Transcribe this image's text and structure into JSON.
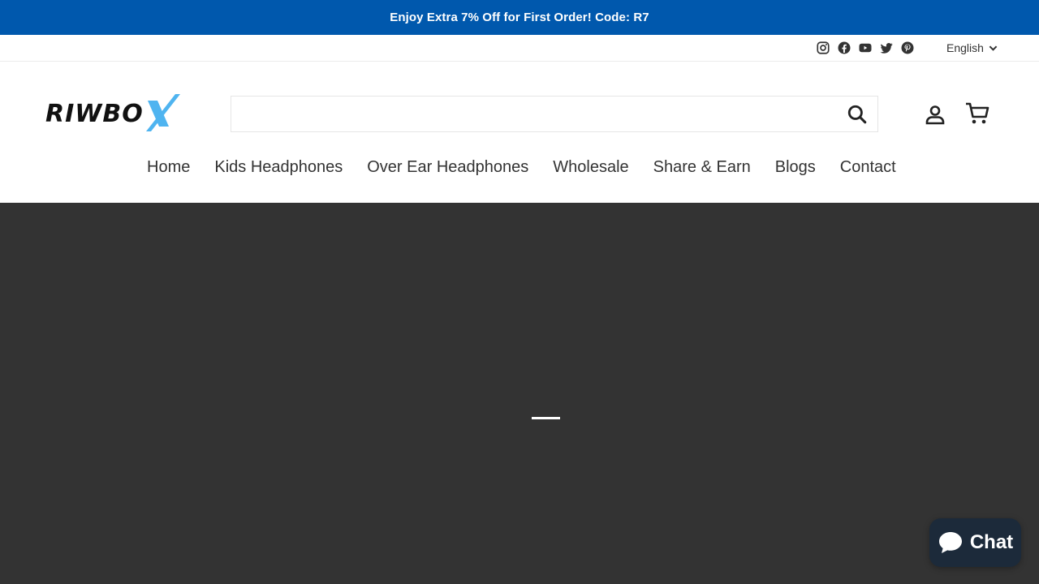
{
  "announcement": {
    "text": "Enjoy Extra 7% Off for First Order! Code: R7"
  },
  "social": [
    "instagram-icon",
    "facebook-icon",
    "youtube-icon",
    "twitter-icon",
    "pinterest-icon"
  ],
  "language": {
    "selected": "English"
  },
  "logo": {
    "text_left": "RIWBO",
    "text_right": "X"
  },
  "search": {
    "value": "",
    "placeholder": ""
  },
  "nav": {
    "items": [
      {
        "label": "Home"
      },
      {
        "label": "Kids Headphones"
      },
      {
        "label": "Over Ear Headphones"
      },
      {
        "label": "Wholesale"
      },
      {
        "label": "Share & Earn"
      },
      {
        "label": "Blogs"
      },
      {
        "label": "Contact"
      }
    ]
  },
  "chat": {
    "label": "Chat"
  },
  "colors": {
    "announcement_bg": "#0058ad",
    "hero_bg": "#333333",
    "chat_bg": "#1c2a3a",
    "logo_accent": "#4fb4f0"
  }
}
